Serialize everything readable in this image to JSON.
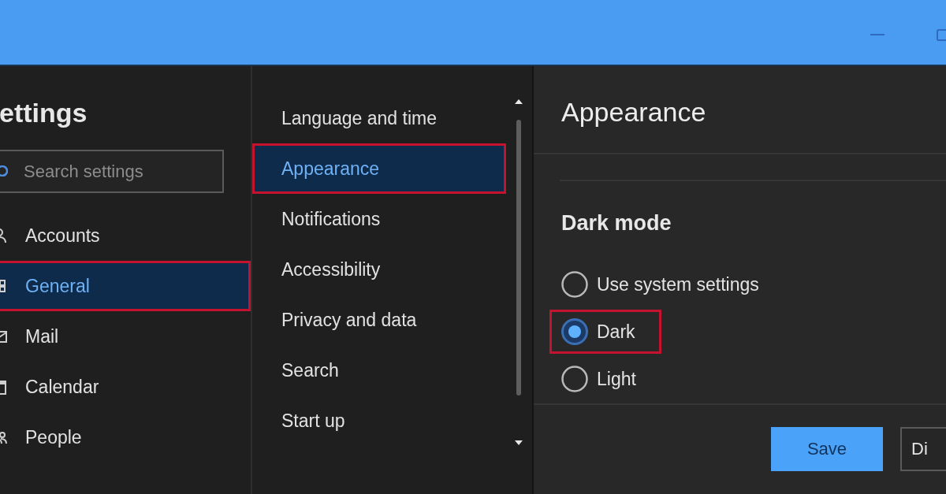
{
  "sidebar": {
    "title": "ettings",
    "search": {
      "placeholder": "Search settings"
    },
    "items": [
      {
        "label": "Accounts",
        "selected": false,
        "outlined": false
      },
      {
        "label": "General",
        "selected": true,
        "outlined": true
      },
      {
        "label": "Mail",
        "selected": false,
        "outlined": false
      },
      {
        "label": "Calendar",
        "selected": false,
        "outlined": false
      },
      {
        "label": "People",
        "selected": false,
        "outlined": false
      }
    ]
  },
  "categories": {
    "items": [
      {
        "label": "Language and time",
        "selected": false,
        "outlined": false
      },
      {
        "label": "Appearance",
        "selected": true,
        "outlined": true
      },
      {
        "label": "Notifications",
        "selected": false,
        "outlined": false
      },
      {
        "label": "Accessibility",
        "selected": false,
        "outlined": false
      },
      {
        "label": "Privacy and data",
        "selected": false,
        "outlined": false
      },
      {
        "label": "Search",
        "selected": false,
        "outlined": false
      },
      {
        "label": "Start up",
        "selected": false,
        "outlined": false
      }
    ]
  },
  "content": {
    "title": "Appearance",
    "section_title": "Dark mode",
    "options": [
      {
        "label": "Use system settings",
        "selected": false,
        "outlined": false
      },
      {
        "label": "Dark",
        "selected": true,
        "outlined": true
      },
      {
        "label": "Light",
        "selected": false,
        "outlined": false
      }
    ],
    "buttons": [
      {
        "label": "Save",
        "kind": "primary"
      },
      {
        "label": "Di",
        "kind": "secondary"
      }
    ]
  }
}
